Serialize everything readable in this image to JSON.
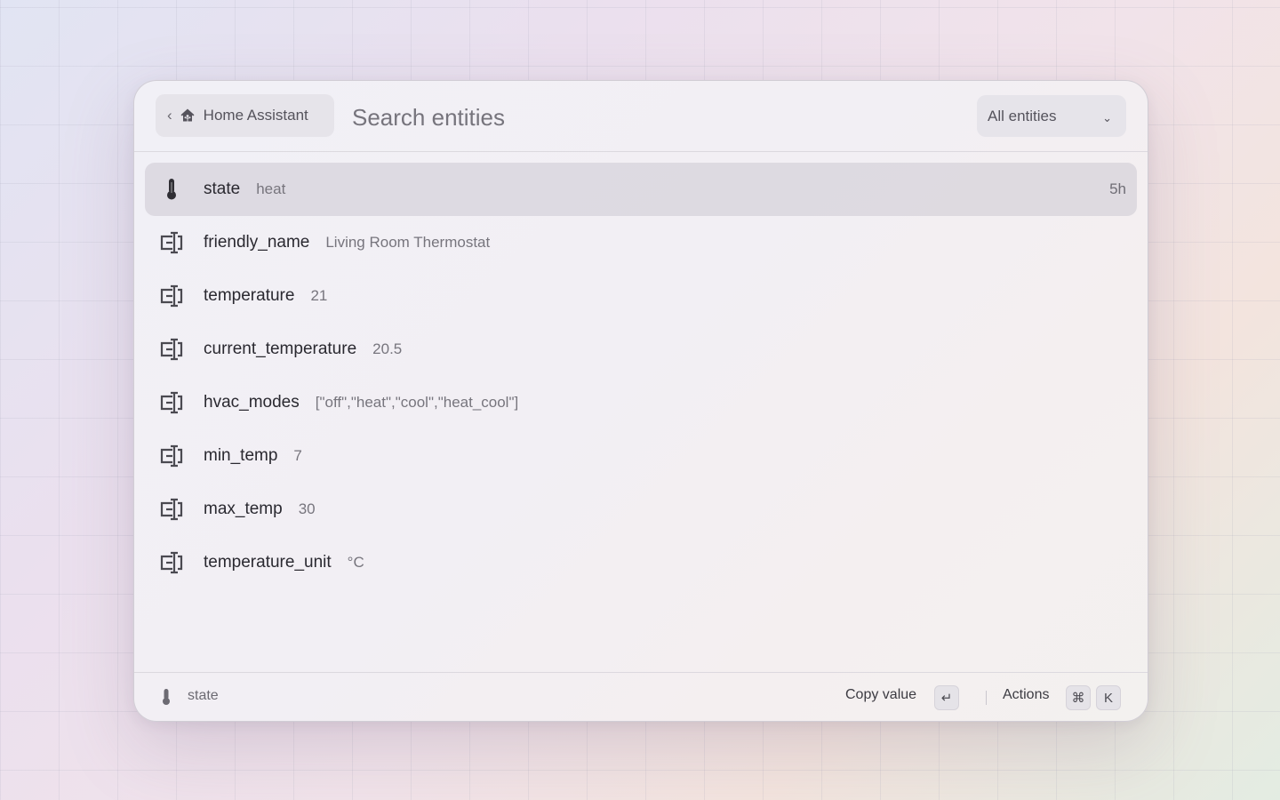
{
  "header": {
    "back_label": "Home Assistant",
    "search_placeholder": "Search entities",
    "filter_label": "All entities"
  },
  "rows": [
    {
      "key": "state",
      "value": "heat",
      "meta": "5h",
      "icon": "thermometer-icon",
      "selected": true
    },
    {
      "key": "friendly_name",
      "value": "Living Room Thermostat",
      "icon": "attribute-icon"
    },
    {
      "key": "temperature",
      "value": "21",
      "icon": "attribute-icon"
    },
    {
      "key": "current_temperature",
      "value": "20.5",
      "icon": "attribute-icon"
    },
    {
      "key": "hvac_modes",
      "value": "[\"off\",\"heat\",\"cool\",\"heat_cool\"]",
      "icon": "attribute-icon"
    },
    {
      "key": "min_temp",
      "value": "7",
      "icon": "attribute-icon"
    },
    {
      "key": "max_temp",
      "value": "30",
      "icon": "attribute-icon"
    },
    {
      "key": "temperature_unit",
      "value": "°C",
      "icon": "attribute-icon"
    }
  ],
  "footer": {
    "selected_label": "state",
    "copy_label": "Copy value",
    "copy_key": "↵",
    "actions_label": "Actions",
    "actions_key_mod": "⌘",
    "actions_key": "K"
  }
}
